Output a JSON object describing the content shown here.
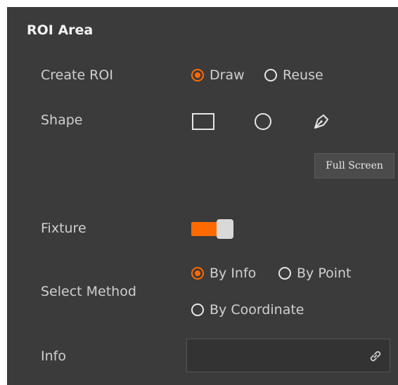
{
  "panel": {
    "title": "ROI Area"
  },
  "create_roi": {
    "label": "Create ROI",
    "options": [
      "Draw",
      "Reuse"
    ],
    "selected": "Draw"
  },
  "shape": {
    "label": "Shape",
    "icons": [
      "rectangle-icon",
      "circle-icon",
      "polygon-pen-icon"
    ]
  },
  "tooltip": {
    "text": "Full Screen"
  },
  "fixture": {
    "label": "Fixture",
    "enabled": true
  },
  "select_method": {
    "label": "Select Method",
    "options": [
      "By Info",
      "By Point",
      "By Coordinate"
    ],
    "selected": "By Info"
  },
  "info": {
    "label": "Info",
    "value": "",
    "icon": "link-icon"
  },
  "colors": {
    "accent": "#ff6a00",
    "panel_bg": "#3b3b3b"
  }
}
